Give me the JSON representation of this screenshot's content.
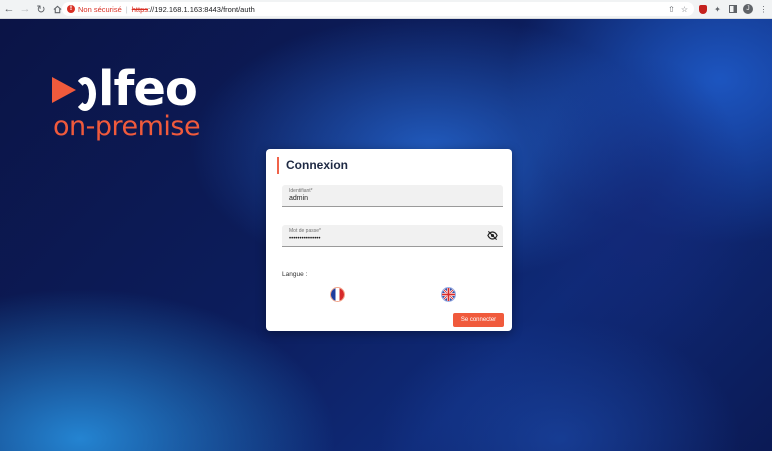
{
  "browser": {
    "security_label": "Non sécurisé",
    "url_scheme": "https",
    "url_rest": "://192.168.1.163:8443/front/auth",
    "profile_initial": "J"
  },
  "logo": {
    "word": "lfeo",
    "sub": "on-premise"
  },
  "login": {
    "title": "Connexion",
    "username_label": "Identifiant*",
    "username_value": "admin",
    "password_label": "Mot de passe*",
    "password_value": "•••••••••••••••",
    "language_label": "Langue :",
    "submit_label": "Se connecter"
  },
  "colors": {
    "accent": "#f05a3c",
    "security_warning": "#d93025"
  }
}
